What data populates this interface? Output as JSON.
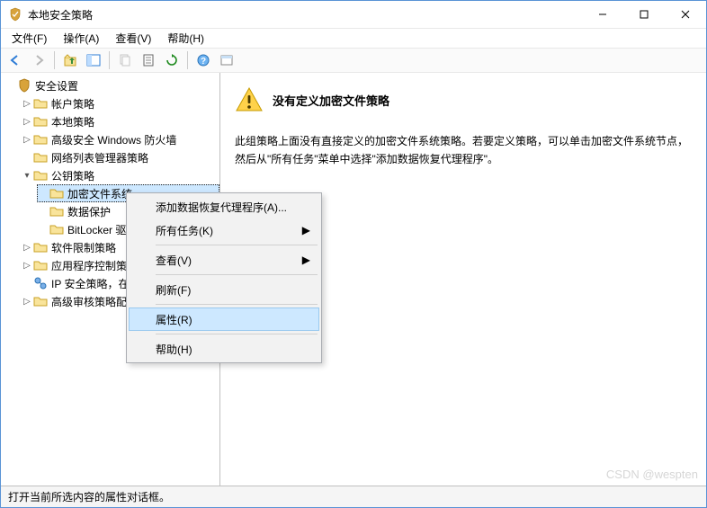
{
  "title": "本地安全策略",
  "menubar": {
    "file": "文件(F)",
    "action": "操作(A)",
    "view": "查看(V)",
    "help": "帮助(H)"
  },
  "tree": {
    "root": "安全设置",
    "account": "帐户策略",
    "local": "本地策略",
    "firewall": "高级安全 Windows 防火墙",
    "netlist": "网络列表管理器策略",
    "pubkey": "公钥策略",
    "efs": "加密文件系统",
    "dataprot": "数据保护",
    "bitlocker": "BitLocker 驱动器加密",
    "bitlocker_short": "BitLocker 驱",
    "softrestrict": "软件限制策略",
    "appctrl": "应用程序控制策略",
    "appctrl_short": "应用程序控制策",
    "ipsec": "IP 安全策略，在 本地计算机",
    "ipsec_short": "IP 安全策略，在",
    "advaudit": "高级审核策略配置",
    "advaudit_short": "高级审核策略配"
  },
  "detail": {
    "heading": "没有定义加密文件策略",
    "body": "此组策略上面没有直接定义的加密文件系统策略。若要定义策略，可以单击加密文件系统节点，然后从\"所有任务\"菜单中选择\"添加数据恢复代理程序\"。"
  },
  "context_menu": {
    "add_agent": "添加数据恢复代理程序(A)...",
    "all_tasks": "所有任务(K)",
    "view": "查看(V)",
    "refresh": "刷新(F)",
    "properties": "属性(R)",
    "help": "帮助(H)"
  },
  "statusbar": "打开当前所选内容的属性对话框。",
  "watermark": "CSDN @wespten"
}
